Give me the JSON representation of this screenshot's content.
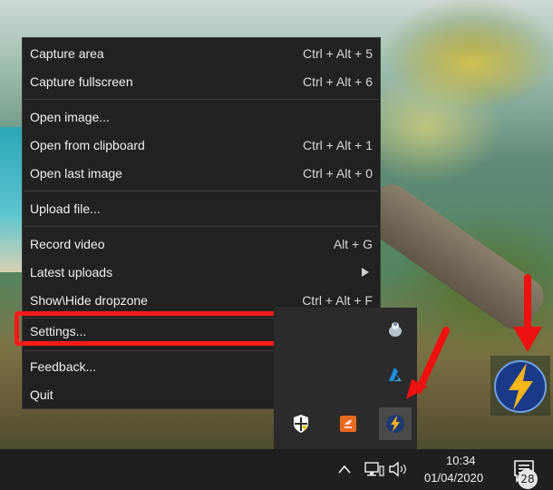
{
  "menu": {
    "items": [
      {
        "label": "Capture area",
        "shortcut": "Ctrl + Alt + 5"
      },
      {
        "label": "Capture fullscreen",
        "shortcut": "Ctrl + Alt + 6"
      },
      {
        "label": "Open image...",
        "shortcut": ""
      },
      {
        "label": "Open from clipboard",
        "shortcut": "Ctrl + Alt + 1"
      },
      {
        "label": "Open last image",
        "shortcut": "Ctrl + Alt + 0"
      },
      {
        "label": "Upload file...",
        "shortcut": ""
      },
      {
        "label": "Record video",
        "shortcut": "Alt + G"
      },
      {
        "label": "Latest uploads",
        "shortcut": ""
      },
      {
        "label": "Show\\Hide dropzone",
        "shortcut": "Ctrl + Alt + F"
      },
      {
        "label": "Settings...",
        "shortcut": ""
      },
      {
        "label": "Feedback...",
        "shortcut": ""
      },
      {
        "label": "Quit",
        "shortcut": ""
      }
    ],
    "latest_uploads_submenu_icon": "chevron-right-icon",
    "highlighted_item": "Settings..."
  },
  "tray_overflow": {
    "icons": [
      "monitor-app-icon",
      "azure-icon",
      "windows-security-icon",
      "java-update-icon",
      "lightning-app-icon"
    ]
  },
  "taskbar": {
    "time": "10:34",
    "date": "01/04/2020",
    "notification_count": "28",
    "icons": [
      "chevron-up-icon",
      "network-icon",
      "volume-icon",
      "action-center-icon"
    ]
  },
  "colors": {
    "menu_bg": "#212121",
    "highlight_red": "#ff1a1a",
    "taskbar_bg": "#1f1f1f"
  }
}
